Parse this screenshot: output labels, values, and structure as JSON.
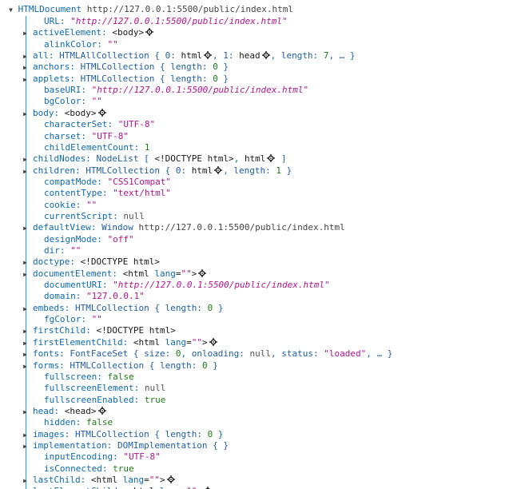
{
  "root": {
    "type": "HTMLDocument",
    "location": "http://127.0.0.1:5500/public/index.html"
  },
  "properties": [
    {
      "expandable": false,
      "key": "URL",
      "parts": [
        {
          "c": "url",
          "t": "\"http://127.0.0.1:5500/public/index.html\""
        }
      ]
    },
    {
      "expandable": true,
      "key": "activeElement",
      "parts": [
        {
          "c": "nod",
          "t": "<body>"
        },
        {
          "c": "gear"
        }
      ]
    },
    {
      "expandable": false,
      "key": "alinkColor",
      "parts": [
        {
          "c": "str",
          "t": "\"\""
        }
      ]
    },
    {
      "expandable": true,
      "key": "all",
      "parts": [
        {
          "c": "typ",
          "t": "HTMLAllCollection { 0: "
        },
        {
          "c": "nod",
          "t": "html"
        },
        {
          "c": "gear"
        },
        {
          "c": "typ",
          "t": ", 1: "
        },
        {
          "c": "nod",
          "t": "head"
        },
        {
          "c": "gear"
        },
        {
          "c": "typ",
          "t": ", length: "
        },
        {
          "c": "num",
          "t": "7"
        },
        {
          "c": "typ",
          "t": ", … }"
        }
      ]
    },
    {
      "expandable": true,
      "key": "anchors",
      "parts": [
        {
          "c": "typ",
          "t": "HTMLCollection { length: "
        },
        {
          "c": "num",
          "t": "0"
        },
        {
          "c": "typ",
          "t": " }"
        }
      ]
    },
    {
      "expandable": true,
      "key": "applets",
      "parts": [
        {
          "c": "typ",
          "t": "HTMLCollection { length: "
        },
        {
          "c": "num",
          "t": "0"
        },
        {
          "c": "typ",
          "t": " }"
        }
      ]
    },
    {
      "expandable": false,
      "key": "baseURI",
      "parts": [
        {
          "c": "url",
          "t": "\"http://127.0.0.1:5500/public/index.html\""
        }
      ]
    },
    {
      "expandable": false,
      "key": "bgColor",
      "parts": [
        {
          "c": "str",
          "t": "\"\""
        }
      ]
    },
    {
      "expandable": true,
      "key": "body",
      "parts": [
        {
          "c": "nod",
          "t": "<body>"
        },
        {
          "c": "gear"
        }
      ]
    },
    {
      "expandable": false,
      "key": "characterSet",
      "parts": [
        {
          "c": "str",
          "t": "\"UTF-8\""
        }
      ]
    },
    {
      "expandable": false,
      "key": "charset",
      "parts": [
        {
          "c": "str",
          "t": "\"UTF-8\""
        }
      ]
    },
    {
      "expandable": false,
      "key": "childElementCount",
      "parts": [
        {
          "c": "num",
          "t": "1"
        }
      ]
    },
    {
      "expandable": true,
      "key": "childNodes",
      "parts": [
        {
          "c": "typ",
          "t": "NodeList [ "
        },
        {
          "c": "nod",
          "t": "<!DOCTYPE html>"
        },
        {
          "c": "typ",
          "t": ", "
        },
        {
          "c": "nod",
          "t": "html"
        },
        {
          "c": "gear"
        },
        {
          "c": "typ",
          "t": " ]"
        }
      ]
    },
    {
      "expandable": true,
      "key": "children",
      "parts": [
        {
          "c": "typ",
          "t": "HTMLCollection { 0: "
        },
        {
          "c": "nod",
          "t": "html"
        },
        {
          "c": "gear"
        },
        {
          "c": "typ",
          "t": ", length: "
        },
        {
          "c": "num",
          "t": "1"
        },
        {
          "c": "typ",
          "t": " }"
        }
      ]
    },
    {
      "expandable": false,
      "key": "compatMode",
      "parts": [
        {
          "c": "str",
          "t": "\"CSS1Compat\""
        }
      ]
    },
    {
      "expandable": false,
      "key": "contentType",
      "parts": [
        {
          "c": "str",
          "t": "\"text/html\""
        }
      ]
    },
    {
      "expandable": false,
      "key": "cookie",
      "parts": [
        {
          "c": "str",
          "t": "\"\""
        }
      ]
    },
    {
      "expandable": false,
      "key": "currentScript",
      "parts": [
        {
          "c": "nul",
          "t": "null"
        }
      ]
    },
    {
      "expandable": true,
      "key": "defaultView",
      "parts": [
        {
          "c": "typ",
          "t": "Window "
        },
        {
          "c": "plain",
          "t": "http://127.0.0.1:5500/public/index.html"
        }
      ]
    },
    {
      "expandable": false,
      "key": "designMode",
      "parts": [
        {
          "c": "str",
          "t": "\"off\""
        }
      ]
    },
    {
      "expandable": false,
      "key": "dir",
      "parts": [
        {
          "c": "str",
          "t": "\"\""
        }
      ]
    },
    {
      "expandable": true,
      "key": "doctype",
      "parts": [
        {
          "c": "nod",
          "t": "<!DOCTYPE html>"
        }
      ]
    },
    {
      "expandable": true,
      "key": "documentElement",
      "parts": [
        {
          "c": "nod",
          "t": "<html "
        },
        {
          "c": "key",
          "t": "lang"
        },
        {
          "c": "nod",
          "t": "="
        },
        {
          "c": "str",
          "t": "\"\""
        },
        {
          "c": "nod",
          "t": ">"
        },
        {
          "c": "gear"
        }
      ]
    },
    {
      "expandable": false,
      "key": "documentURI",
      "parts": [
        {
          "c": "url",
          "t": "\"http://127.0.0.1:5500/public/index.html\""
        }
      ]
    },
    {
      "expandable": false,
      "key": "domain",
      "parts": [
        {
          "c": "str",
          "t": "\"127.0.0.1\""
        }
      ]
    },
    {
      "expandable": true,
      "key": "embeds",
      "parts": [
        {
          "c": "typ",
          "t": "HTMLCollection { length: "
        },
        {
          "c": "num",
          "t": "0"
        },
        {
          "c": "typ",
          "t": " }"
        }
      ]
    },
    {
      "expandable": false,
      "key": "fgColor",
      "parts": [
        {
          "c": "str",
          "t": "\"\""
        }
      ]
    },
    {
      "expandable": true,
      "key": "firstChild",
      "parts": [
        {
          "c": "nod",
          "t": "<!DOCTYPE html>"
        }
      ]
    },
    {
      "expandable": true,
      "key": "firstElementChild",
      "parts": [
        {
          "c": "nod",
          "t": "<html "
        },
        {
          "c": "key",
          "t": "lang"
        },
        {
          "c": "nod",
          "t": "="
        },
        {
          "c": "str",
          "t": "\"\""
        },
        {
          "c": "nod",
          "t": ">"
        },
        {
          "c": "gear"
        }
      ]
    },
    {
      "expandable": true,
      "key": "fonts",
      "parts": [
        {
          "c": "typ",
          "t": "FontFaceSet { size: "
        },
        {
          "c": "num",
          "t": "0"
        },
        {
          "c": "typ",
          "t": ", onloading: "
        },
        {
          "c": "nul",
          "t": "null"
        },
        {
          "c": "typ",
          "t": ", status: "
        },
        {
          "c": "str",
          "t": "\"loaded\""
        },
        {
          "c": "typ",
          "t": ", … }"
        }
      ]
    },
    {
      "expandable": true,
      "key": "forms",
      "parts": [
        {
          "c": "typ",
          "t": "HTMLCollection { length: "
        },
        {
          "c": "num",
          "t": "0"
        },
        {
          "c": "typ",
          "t": " }"
        }
      ]
    },
    {
      "expandable": false,
      "key": "fullscreen",
      "parts": [
        {
          "c": "kw",
          "t": "false"
        }
      ]
    },
    {
      "expandable": false,
      "key": "fullscreenElement",
      "parts": [
        {
          "c": "nul",
          "t": "null"
        }
      ]
    },
    {
      "expandable": false,
      "key": "fullscreenEnabled",
      "parts": [
        {
          "c": "kw",
          "t": "true"
        }
      ]
    },
    {
      "expandable": true,
      "key": "head",
      "parts": [
        {
          "c": "nod",
          "t": "<head>"
        },
        {
          "c": "gear"
        }
      ]
    },
    {
      "expandable": false,
      "key": "hidden",
      "parts": [
        {
          "c": "kw",
          "t": "false"
        }
      ]
    },
    {
      "expandable": true,
      "key": "images",
      "parts": [
        {
          "c": "typ",
          "t": "HTMLCollection { length: "
        },
        {
          "c": "num",
          "t": "0"
        },
        {
          "c": "typ",
          "t": " }"
        }
      ]
    },
    {
      "expandable": true,
      "key": "implementation",
      "parts": [
        {
          "c": "typ",
          "t": "DOMImplementation {  }"
        }
      ]
    },
    {
      "expandable": false,
      "key": "inputEncoding",
      "parts": [
        {
          "c": "str",
          "t": "\"UTF-8\""
        }
      ]
    },
    {
      "expandable": false,
      "key": "isConnected",
      "parts": [
        {
          "c": "kw",
          "t": "true"
        }
      ]
    },
    {
      "expandable": true,
      "key": "lastChild",
      "parts": [
        {
          "c": "nod",
          "t": "<html "
        },
        {
          "c": "key",
          "t": "lang"
        },
        {
          "c": "nod",
          "t": "="
        },
        {
          "c": "str",
          "t": "\"\""
        },
        {
          "c": "nod",
          "t": ">"
        },
        {
          "c": "gear"
        }
      ]
    },
    {
      "expandable": true,
      "key": "lastElementChild",
      "parts": [
        {
          "c": "nod",
          "t": "<html "
        },
        {
          "c": "key",
          "t": "lang"
        },
        {
          "c": "nod",
          "t": "="
        },
        {
          "c": "str",
          "t": "\"\""
        },
        {
          "c": "nod",
          "t": ">"
        },
        {
          "c": "gear"
        }
      ]
    }
  ],
  "icons": {
    "twisty_closed": "triangle-right-icon",
    "twisty_open": "triangle-down-icon",
    "inspect": "crosshair-gear-icon"
  },
  "colors": {
    "key": "#0d6ab0",
    "string": "#b2138e",
    "number": "#1c7a16",
    "guide": "#1e9bd8"
  }
}
